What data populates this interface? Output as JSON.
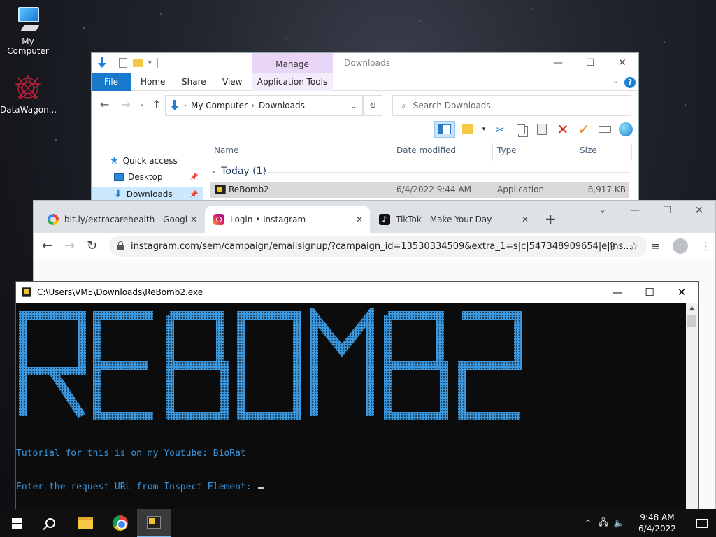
{
  "desktop": {
    "icons": [
      {
        "label": "My Computer",
        "icon": "computer-icon"
      },
      {
        "label": "DataWagon...",
        "icon": "datawagon-icon"
      }
    ]
  },
  "explorer": {
    "title": "Downloads",
    "manage_label": "Manage",
    "tabs": [
      "File",
      "Home",
      "Share",
      "View",
      "Application Tools"
    ],
    "breadcrumb": [
      "My Computer",
      "Downloads"
    ],
    "search_placeholder": "Search Downloads",
    "nav_items": [
      "Quick access",
      "Desktop",
      "Downloads"
    ],
    "columns": [
      "Name",
      "Date modified",
      "Type",
      "Size"
    ],
    "group": "Today (1)",
    "files": [
      {
        "name": "ReBomb2",
        "date": "6/4/2022 9:44 AM",
        "type": "Application",
        "size": "8,917 KB"
      }
    ]
  },
  "browser": {
    "tabs": [
      {
        "title": "bit.ly/extracarehealth - Google S",
        "favicon": "google-icon",
        "active": false
      },
      {
        "title": "Login • Instagram",
        "favicon": "instagram-icon",
        "active": true
      },
      {
        "title": "TikTok - Make Your Day",
        "favicon": "tiktok-icon",
        "active": false
      }
    ],
    "url": "instagram.com/sem/campaign/emailsignup/?campaign_id=13530334509&extra_1=s|c|547348909654|e|ins..."
  },
  "console": {
    "title": "C:\\Users\\VM5\\Downloads\\ReBomb2.exe",
    "banner_text": "REBOMB2",
    "line1": "Tutorial for this is on my Youtube: BioRat",
    "line2": "Enter the request URL from Inspect Element: ",
    "text_color": "#3a96dd"
  },
  "taskbar": {
    "time": "9:48 AM",
    "date": "6/4/2022"
  }
}
